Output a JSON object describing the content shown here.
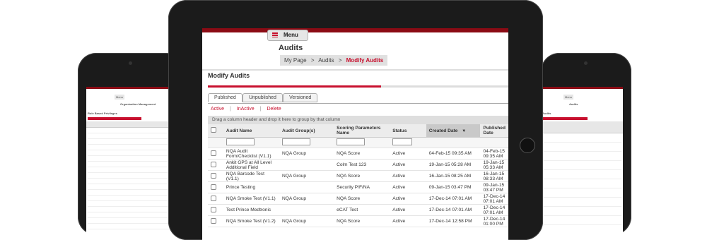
{
  "menu": {
    "label": "Menu"
  },
  "page_title": "Audits",
  "breadcrumb": {
    "home": "My Page",
    "sep": ">",
    "mid": "Audits",
    "current": "Modify Audits"
  },
  "section_title": "Modify Audits",
  "tabs": [
    {
      "label": "Published",
      "active": true
    },
    {
      "label": "Unpublished",
      "active": false
    },
    {
      "label": "Versioned",
      "active": false
    }
  ],
  "actions": {
    "active": "Active",
    "inactive": "InActive",
    "delete": "Delete",
    "sep": "|"
  },
  "group_hint": "Drag a column header and drop it here to group by that column",
  "columns": [
    "Audit Name",
    "Audit Group(s)",
    "Scoring Parameters Name",
    "Status",
    "Created Date",
    "Published Date"
  ],
  "sort_icon": "sort-descending-icon",
  "rows": [
    [
      "NQA Audit Form/Checklist (V1.1)",
      "NQA Group",
      "NQA Score",
      "Active",
      "04-Feb-15 09:35 AM",
      "04-Feb-15 09:35 AM"
    ],
    [
      "Ankit GPS at All Level Additional Field",
      "",
      "Colm Test 123",
      "Active",
      "19-Jan-15 05:28 AM",
      "19-Jan-15 05:33 AM"
    ],
    [
      "NQA Barcode Test (V1.1)",
      "NQA Group",
      "NQA Score",
      "Active",
      "16-Jan-15 08:25 AM",
      "16-Jan-15 08:33 AM"
    ],
    [
      "Prince Testing",
      "",
      "Security P/F/NA",
      "Active",
      "09-Jan-15 03:47 PM",
      "09-Jan-15 03:47 PM"
    ],
    [
      "NQA Smoke Test (V1.1)",
      "NQA Group",
      "NQA Score",
      "Active",
      "17-Dec-14 07:01 AM",
      "17-Dec-14 07:01 AM"
    ],
    [
      "Test Prince Medtronic",
      "",
      "eCAT Test",
      "Active",
      "17-Dec-14 07:01 AM",
      "17-Dec-14 07:01 AM"
    ],
    [
      "NQA Smoke Test (V1.2)",
      "NQA Group",
      "NQA Score",
      "Active",
      "17-Dec-14 12:58 PM",
      "17-Dec-14 01:00 PM"
    ]
  ],
  "left_tablet": {
    "title": "Organisation Management",
    "menu": "Menu",
    "section": "Role Based Privileges"
  },
  "right_tablet": {
    "title": "Audits",
    "menu": "Menu",
    "section": "Audits"
  },
  "colors": {
    "accent": "#c8102e",
    "band": "#8b0b14",
    "bezel": "#1b1b1b"
  }
}
